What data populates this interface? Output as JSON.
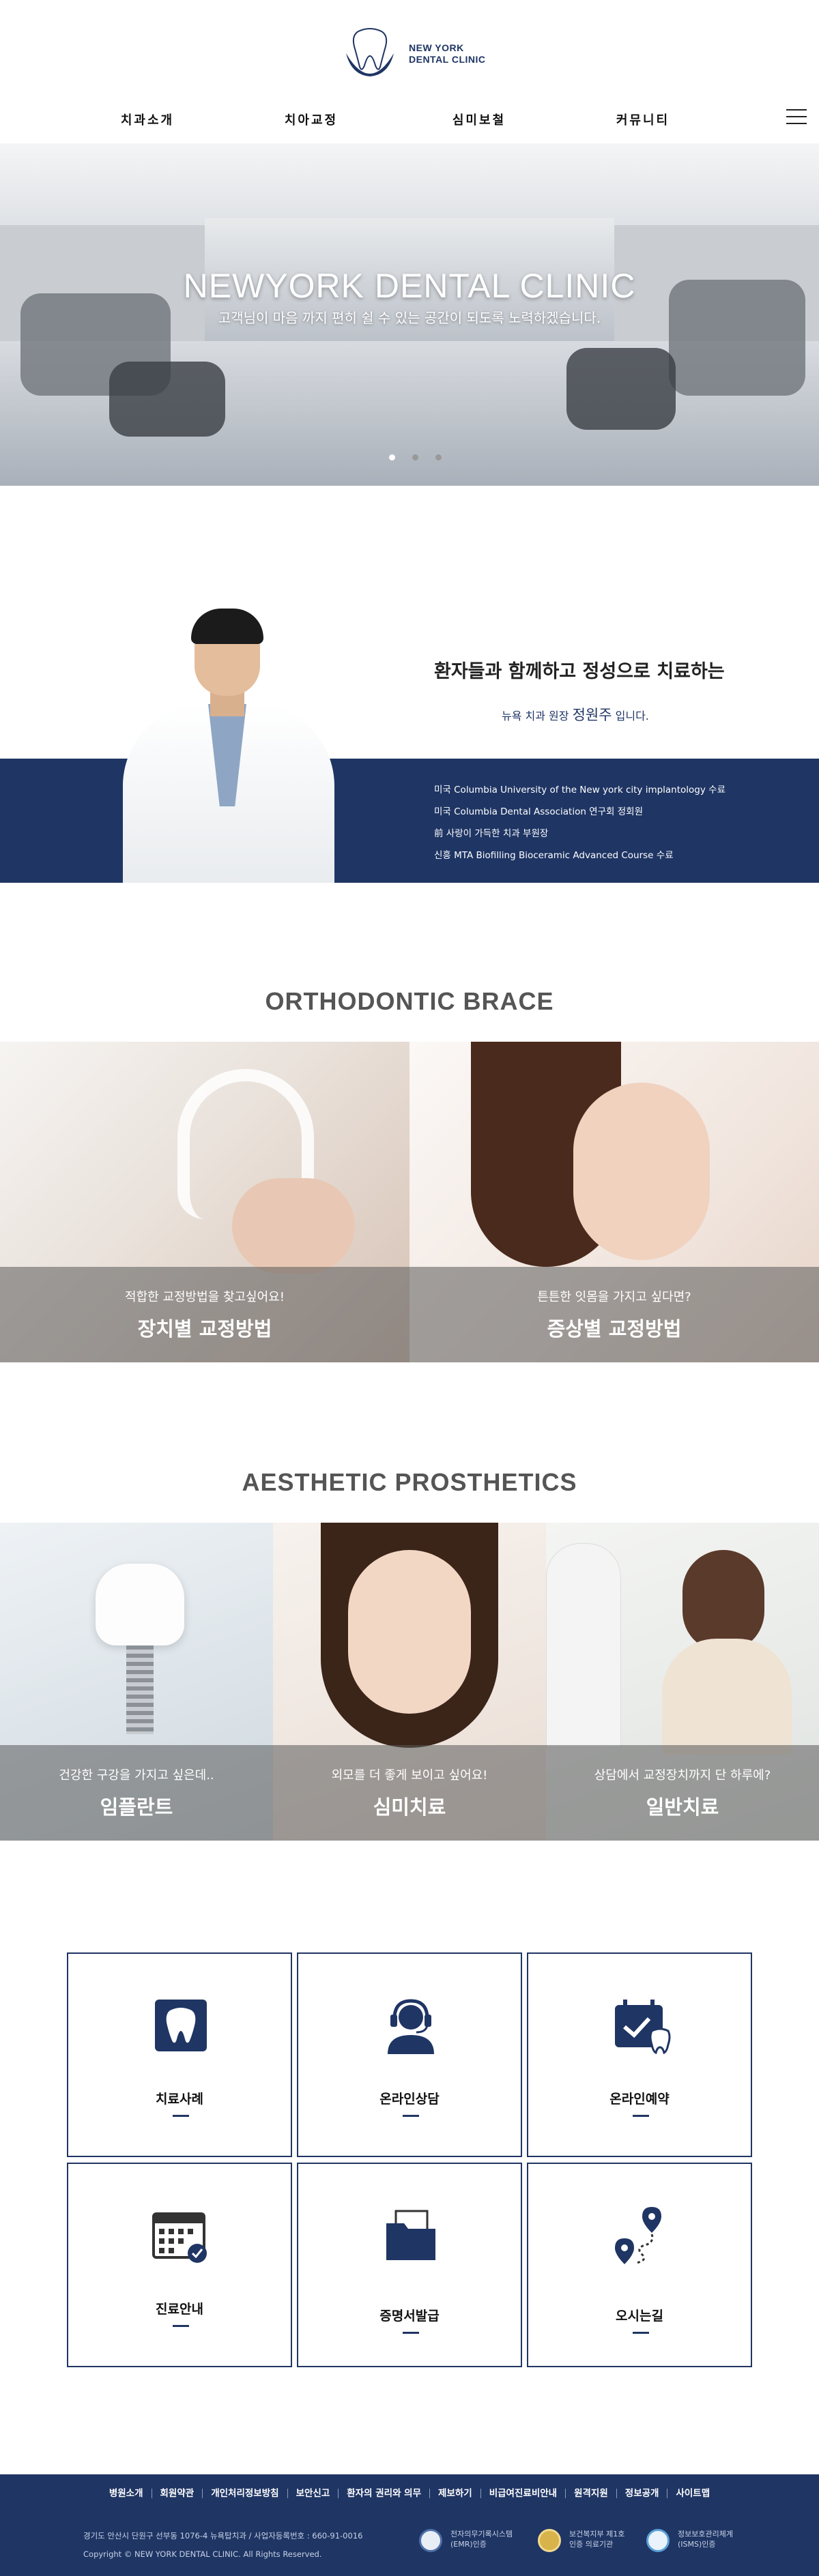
{
  "header": {
    "logo_line1": "NEW YORK",
    "logo_line2": "DENTAL CLINIC",
    "nav": [
      "치과소개",
      "치아교정",
      "심미보철",
      "커뮤니티"
    ]
  },
  "hero": {
    "title": "NEWYORK DENTAL CLINIC",
    "subtitle": "고객님이 마음 까지 편히 쉴 수 있는 공간이 되도록 노력하겠습니다."
  },
  "doctor": {
    "headline": "환자들과 함께하고 정성으로 치료하는",
    "intro_prefix": "뉴욕 치과  원장 ",
    "name": "정원주",
    "intro_suffix": " 입니다.",
    "credentials": [
      "미국 Columbia University of the New york city implantology 수료",
      "미국 Columbia Dental Association 연구회 정회원",
      "前 사랑이 가득한 치과 부원장",
      "신흥 MTA Biofilling Bioceramic Advanced Course 수료"
    ]
  },
  "orthodontic": {
    "title": "ORTHODONTIC BRACE",
    "cards": [
      {
        "question": "적합한 교정방법을 찾고싶어요!",
        "label": "장치별 교정방법"
      },
      {
        "question": "튼튼한 잇몸을 가지고 싶다면?",
        "label": "증상별 교정방법"
      }
    ]
  },
  "aesthetic": {
    "title": "AESTHETIC PROSTHETICS",
    "cards": [
      {
        "question": "건강한 구강을 가지고 싶은데..",
        "label": "임플란트"
      },
      {
        "question": "외모를 더 좋게 보이고 싶어요!",
        "label": "심미치료"
      },
      {
        "question": "상담에서 교정장치까지 단 하루에?",
        "label": "일반치료"
      }
    ]
  },
  "quick_menu": [
    {
      "label": "치료사례",
      "icon": "tooth-icon"
    },
    {
      "label": "온라인상담",
      "icon": "headset-icon"
    },
    {
      "label": "온라인예약",
      "icon": "calendar-tooth-icon"
    },
    {
      "label": "진료안내",
      "icon": "calendar-check-icon"
    },
    {
      "label": "증명서발급",
      "icon": "folder-icon"
    },
    {
      "label": "오시는길",
      "icon": "map-pin-icon"
    }
  ],
  "footer": {
    "links": [
      "병원소개",
      "회원약관",
      "개인처리정보방침",
      "보안신고",
      "환자의 권리와 의무",
      "제보하기",
      "비급여진료비안내",
      "원격지원",
      "정보공개",
      "사이트맵"
    ],
    "address": "경기도 안산시 단원구 선부동 1076-4 뉴욕탑치과 / 사업자등록번호 : 660-91-0016",
    "copyright": "Copyright © NEW YORK DENTAL CLINIC. All Rights Reserved.",
    "badges": [
      {
        "line1": "전자의무기록시스템",
        "line2": "(EMR)인증"
      },
      {
        "line1": "보건복지부 제1호",
        "line2": "인증 의료기관"
      },
      {
        "line1": "정보보호관리체계",
        "line2": "(ISMS)인증"
      }
    ]
  },
  "colors": {
    "brand_navy": "#1f3564",
    "overlay_gray": "#5a5a5a"
  }
}
